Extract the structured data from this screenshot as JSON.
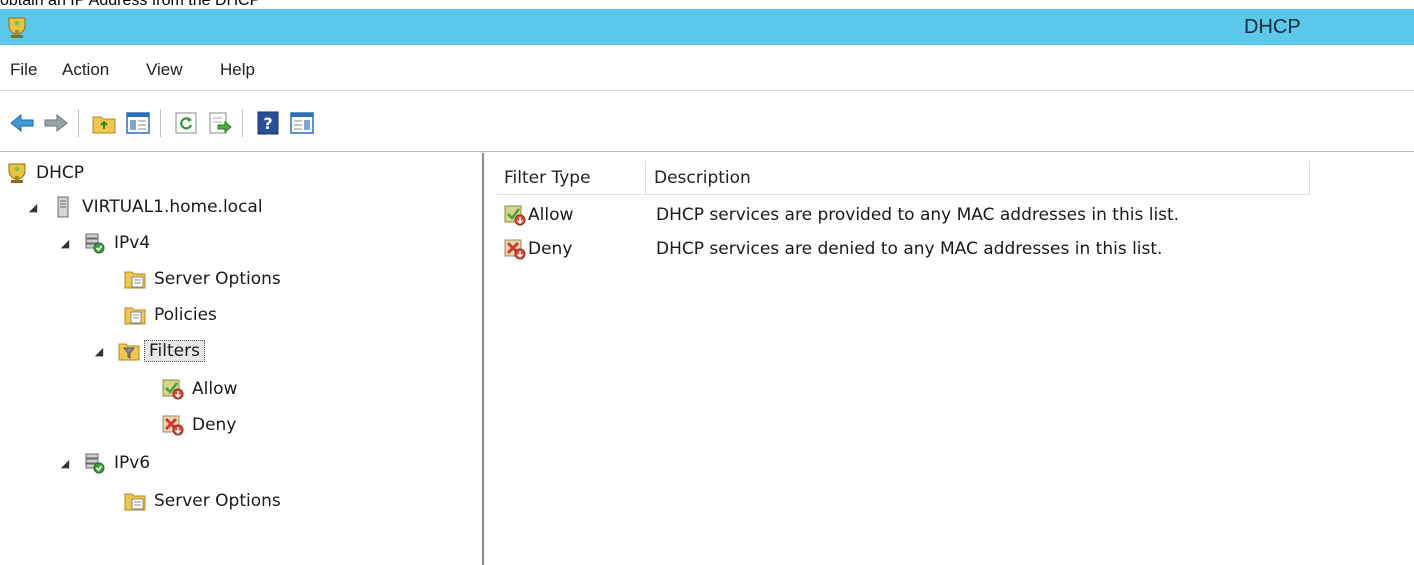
{
  "caption": "obtain an IP Address from the DHCP",
  "window": {
    "title": "DHCP",
    "title_bar_color": "#5bc7ea"
  },
  "menu": [
    "File",
    "Action",
    "View",
    "Help"
  ],
  "toolbar": {
    "buttons": [
      "back-icon",
      "forward-icon",
      "up-folder-icon",
      "show-hide-tree-icon",
      "refresh-icon",
      "export-list-icon",
      "help-icon",
      "show-hide-action-pane-icon"
    ]
  },
  "tree": {
    "root": "DHCP",
    "server": "VIRTUAL1.home.local",
    "ipv4": "IPv4",
    "ipv4_server_options": "Server Options",
    "policies": "Policies",
    "filters": "Filters",
    "allow": "Allow",
    "deny": "Deny",
    "ipv6": "IPv6",
    "ipv6_server_options": "Server Options"
  },
  "list": {
    "columns": [
      "Filter Type",
      "Description"
    ],
    "rows": [
      {
        "type": "Allow",
        "description": "DHCP services are provided to any MAC addresses in this list."
      },
      {
        "type": "Deny",
        "description": "DHCP services are denied to any MAC addresses in this list."
      }
    ]
  }
}
